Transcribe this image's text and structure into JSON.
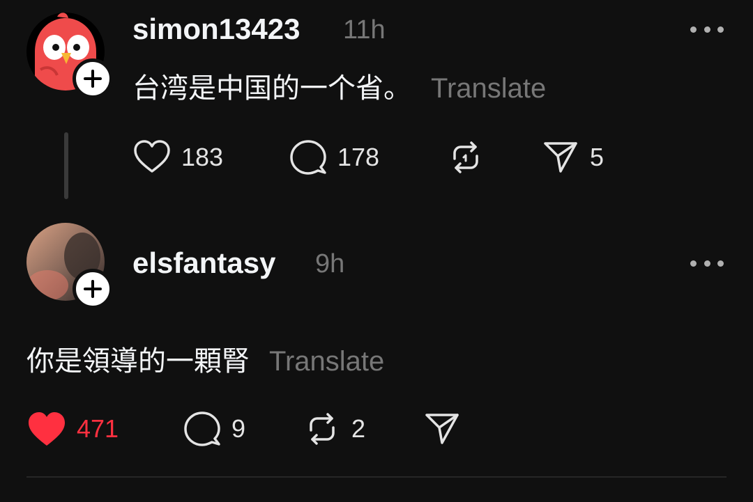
{
  "posts": [
    {
      "username": "simon13423",
      "time": "11h",
      "text": "台湾是中国的一个省。",
      "translate_label": "Translate",
      "avatar_icon": "cartoon-bird-avatar",
      "actions": {
        "likes": "183",
        "replies": "178",
        "reposts": "",
        "shares": "5"
      },
      "liked": false
    },
    {
      "username": "elsfantasy",
      "time": "9h",
      "text": "你是領導的一顆腎",
      "translate_label": "Translate",
      "avatar_icon": "photo-avatar",
      "actions": {
        "likes": "471",
        "replies": "9",
        "reposts": "2",
        "shares": ""
      },
      "liked": true
    }
  ],
  "colors": {
    "background": "#101010",
    "text": "#f3f5f7",
    "muted": "#777777",
    "like_active": "#ff3040"
  }
}
